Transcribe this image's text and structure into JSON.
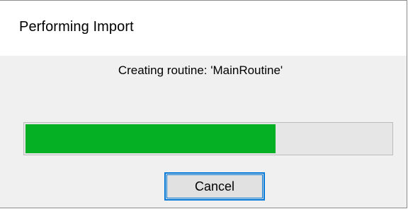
{
  "dialog": {
    "title": "Performing Import",
    "status_text": "Creating routine: 'MainRoutine'",
    "progress": 0.685,
    "progress_color": "#06b025",
    "cancel_label": "Cancel",
    "accent_color": "#0078d7"
  }
}
